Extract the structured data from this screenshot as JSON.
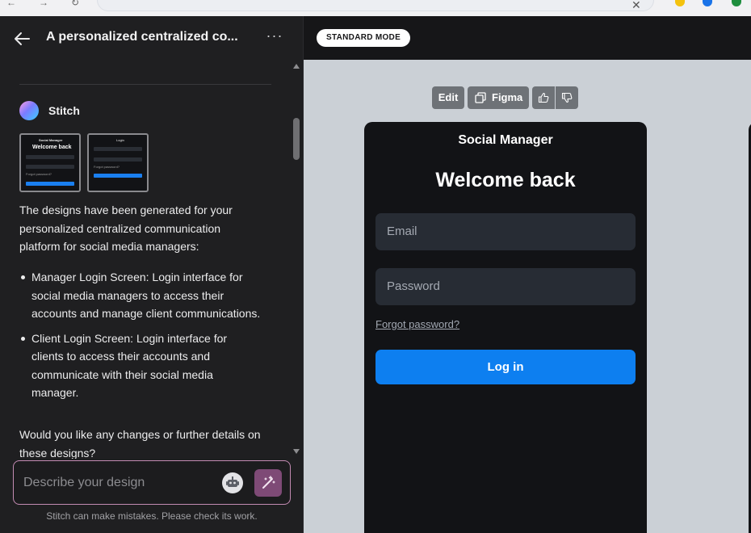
{
  "browser": {
    "close_glyph": "✕"
  },
  "header": {
    "back_icon": "arrow-left-icon",
    "title": "A personalized centralized co...",
    "more_glyph": "···"
  },
  "chat": {
    "bot_name": "Stitch",
    "thumbnails": [
      {
        "title": "Welcome back",
        "header": "Social Manager",
        "fields": [
          "Email",
          "Password"
        ],
        "link": "Forgot password?",
        "button": "Log in"
      },
      {
        "title": "Login",
        "fields": [
          "Email",
          "Password"
        ],
        "link": "Forgot password?",
        "button": "Log in"
      }
    ],
    "intro": "The designs have been generated for your personalized centralized communication platform for social media managers:",
    "bullets": [
      "Manager Login Screen: Login interface for social media managers to access their accounts and manage client communications.",
      "Client Login Screen: Login interface for clients to access their accounts and communicate with their social media manager."
    ],
    "question": "Would you like any changes or further details on these designs?"
  },
  "composer": {
    "placeholder": "Describe your design",
    "robot_icon": "robot-icon",
    "send_icon": "magic-wand-icon"
  },
  "disclaimer": "Stitch can make mistakes. Please check its work.",
  "canvas": {
    "mode": "STANDARD MODE",
    "toolbar": {
      "edit": "Edit",
      "figma": "Figma"
    },
    "screen": {
      "app_name": "Social Manager",
      "heading": "Welcome back",
      "email_placeholder": "Email",
      "password_placeholder": "Password",
      "forgot": "Forgot password?",
      "login": "Log in"
    }
  },
  "colors": {
    "panel_bg": "#1f1f21",
    "canvas_bg": "#cbd0d6",
    "primary_button": "#0d7ff0",
    "composer_border": "#c38bb3",
    "send_button": "#7e4a76"
  }
}
